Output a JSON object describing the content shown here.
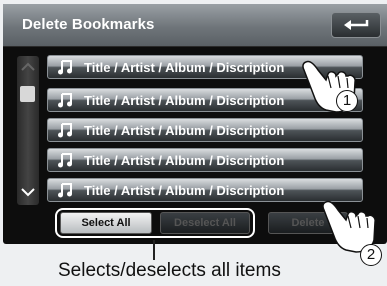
{
  "header": {
    "title": "Delete Bookmarks",
    "back_icon": "back-arrow-icon"
  },
  "list": {
    "rows": [
      {
        "label": "Title / Artist / Album / Discription",
        "icon": "music-note-icon"
      },
      {
        "label": "Title / Artist / Album / Discription",
        "icon": "music-note-icon"
      },
      {
        "label": "Title / Artist / Album / Discription",
        "icon": "music-note-icon"
      },
      {
        "label": "Title / Artist / Album / Discription",
        "icon": "music-note-icon"
      },
      {
        "label": "Title / Artist / Album / Discription",
        "icon": "music-note-icon"
      }
    ]
  },
  "buttons": {
    "select_all": "Select All",
    "deselect_all": "Deselect All",
    "delete": "Delete"
  },
  "callouts": {
    "step1": "1",
    "step2": "2",
    "caption": "Selects/deselects all items"
  },
  "colors": {
    "screen_bg": "#0d0d0d",
    "row_gradient_top": "#d9dcdf",
    "row_gradient_bottom": "#2a2e31",
    "highlight_border": "#ffffff"
  }
}
